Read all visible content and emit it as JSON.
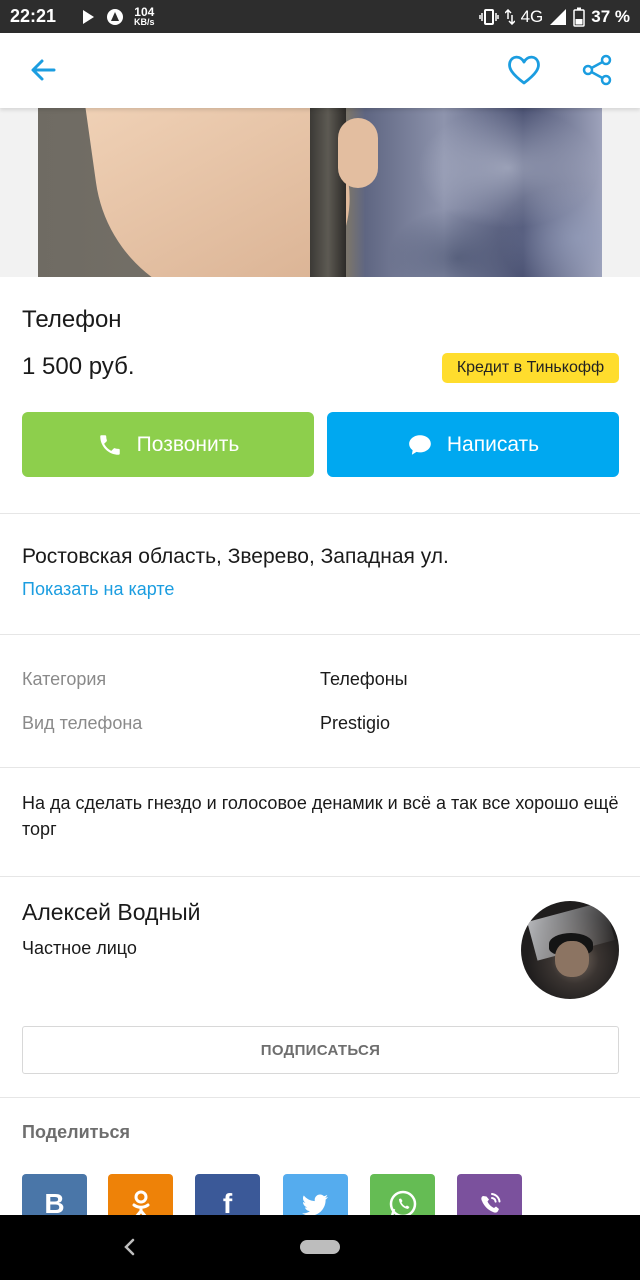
{
  "status_bar": {
    "time": "22:21",
    "speed_value": "104",
    "speed_unit": "KB/s",
    "network": "4G",
    "battery_percent": "37 %",
    "icons": [
      "play-icon",
      "app-notification-icon",
      "vibrate-icon",
      "signal-icon",
      "battery-icon"
    ]
  },
  "toolbar": {
    "back_icon": "arrow-left-icon",
    "favorite_icon": "heart-icon",
    "share_icon": "share-icon",
    "accent_color": "#1b9de0"
  },
  "listing": {
    "title": "Телефон",
    "price": "1 500 руб.",
    "credit_badge": "Кредит в Тинькофф"
  },
  "actions": {
    "call_label": "Позвонить",
    "write_label": "Написать",
    "call_color": "#8dcf4c",
    "write_color": "#00a8f0"
  },
  "location": {
    "address": "Ростовская область, Зверево, Западная ул.",
    "map_link": "Показать на карте"
  },
  "params": [
    {
      "label": "Категория",
      "value": "Телефоны"
    },
    {
      "label": "Вид телефона",
      "value": "Prestigio"
    }
  ],
  "description": "На да сделать гнездо и голосовое денамик и всё а так все хорошо ещё торг",
  "seller": {
    "name": "Алексей Водный",
    "type": "Частное лицо",
    "subscribe_label": "ПОДПИСАТЬСЯ"
  },
  "share": {
    "title": "Поделиться",
    "networks": [
      {
        "name": "vk",
        "label": "В",
        "color": "#4a76a8"
      },
      {
        "name": "odnoklassniki",
        "label": "ок",
        "color": "#ee8208"
      },
      {
        "name": "facebook",
        "label": "f",
        "color": "#3b5998"
      },
      {
        "name": "twitter",
        "label": "",
        "color": "#55acee"
      },
      {
        "name": "whatsapp",
        "label": "",
        "color": "#65bc54"
      },
      {
        "name": "viber",
        "label": "",
        "color": "#7b519d"
      }
    ]
  }
}
